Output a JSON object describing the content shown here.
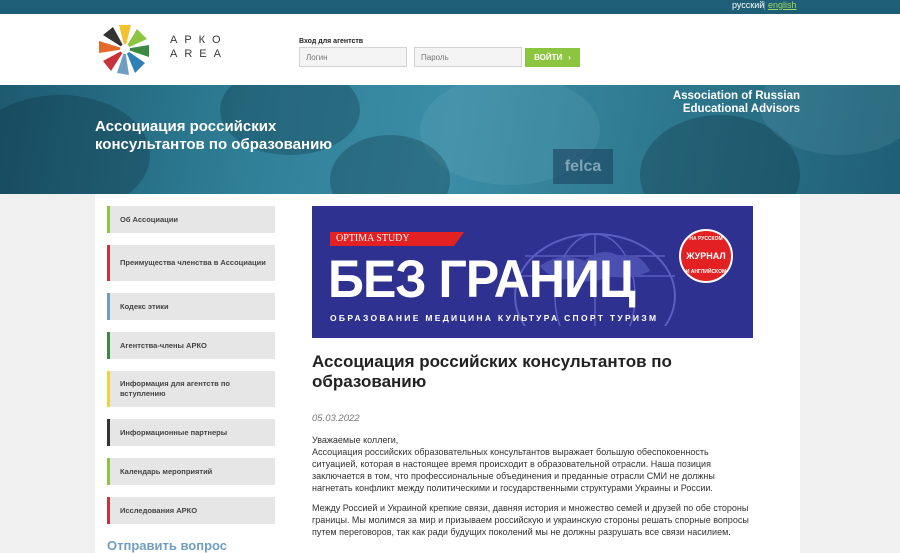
{
  "lang": {
    "ru": "русский",
    "sep": "|",
    "en": "english"
  },
  "logo": {
    "line1": "АРКО",
    "line2": "AREA"
  },
  "login": {
    "title": "Вход для агентств",
    "login_placeholder": "Логин",
    "password_placeholder": "Пароль",
    "button_label": "ВОЙТИ",
    "button_arrow": "›"
  },
  "banner": {
    "title": "Ассоциация российских консультантов по образованию",
    "en_line1": "Association of Russian",
    "en_line2": "Educational Advisors",
    "felca": "felca"
  },
  "sidebar": {
    "items": [
      {
        "label": "Об Ассоциации",
        "color": "#8cc540"
      },
      {
        "label": "Преимущества членства в Ассоциации",
        "color": "#c8323a"
      },
      {
        "label": "Кодекс этики",
        "color": "#6f9fc0"
      },
      {
        "label": "Агентства-члены АРКО",
        "color": "#3b8a3e"
      },
      {
        "label": "Информация для агентств по вступлению",
        "color": "#f2d23c"
      },
      {
        "label": "Информационные партнеры",
        "color": "#333333"
      },
      {
        "label": "Календарь мероприятий",
        "color": "#8cc540"
      },
      {
        "label": "Исследования АРКО",
        "color": "#c8323a"
      }
    ],
    "ask": "Отправить вопрос"
  },
  "ad": {
    "brand": "OPTIMA STUDY",
    "title": "БЕЗ ГРАНИЦ",
    "subtitle": "ОБРАЗОВАНИЕ  МЕДИЦИНА  КУЛЬТУРА  СПОРТ  ТУРИЗМ",
    "stamp_top": "НА РУССКОМ",
    "stamp_mid": "ЖУРНАЛ",
    "stamp_bottom": "И АНГЛИЙСКОМ"
  },
  "article": {
    "title": "Ассоциация российских консультантов по образованию",
    "date": "05.03.2022",
    "greeting": "Уважаемые коллеги,",
    "para1": "Ассоциация российских образовательных консультантов выражает большую обеспокоенность ситуацией, которая в настоящее время происходит в образовательной отрасли. Наша позиция заключается в том, что профессиональные объединения и преданные отрасли СМИ не должны нагнетать конфликт между политическими и государственными структурами Украины и России.",
    "para2": "Между Россией и Украиной крепкие связи, давняя история и множество семей и друзей по обе стороны границы. Мы молимся за мир и призываем российскую и украинскую стороны решать спорные вопросы путем переговоров, так как ради будущих поколений мы не должны разрушать все связи насилием."
  }
}
